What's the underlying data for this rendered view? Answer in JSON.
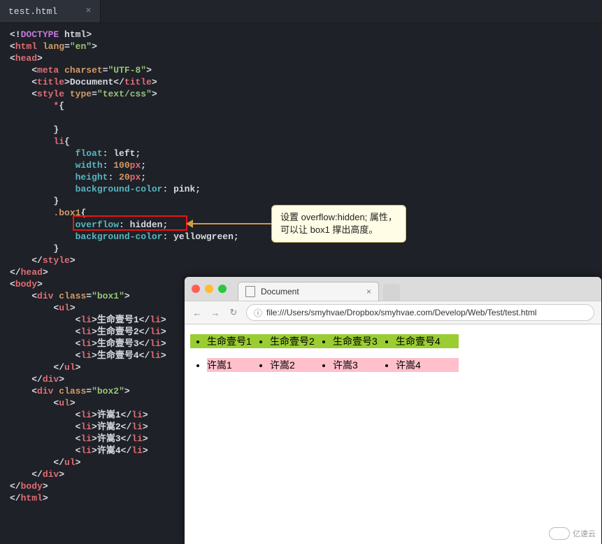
{
  "editor": {
    "tab": {
      "filename": "test.html",
      "close_glyph": "×"
    },
    "code": {
      "doctype": {
        "open": "<!",
        "tag": "DOCTYPE",
        "rest": " html",
        "close": ">"
      },
      "html_tag": {
        "name": "html",
        "attr": "lang",
        "val": "\"en\""
      },
      "head_tag": "head",
      "meta": {
        "name": "meta",
        "attr": "charset",
        "val": "\"UTF-8\""
      },
      "title": {
        "name": "title",
        "text": "Document"
      },
      "style": {
        "name": "style",
        "attr": "type",
        "val": "\"text/css\""
      },
      "rule_star": "*{",
      "rule_li": "li{",
      "li_props": {
        "float": {
          "k": "float",
          "v": "left"
        },
        "width": {
          "k": "width",
          "n": "100",
          "u": "px"
        },
        "height": {
          "k": "height",
          "n": "20",
          "u": "px"
        },
        "bgcolor": {
          "k": "background-color",
          "v": "pink"
        }
      },
      "box1_rule": {
        "sel": ".box1",
        "open": "{"
      },
      "overflow": {
        "k": "overflow",
        "v": "hidden"
      },
      "box1_bg": {
        "k": "background-color",
        "v": "yellowgreen"
      },
      "body_tag": "body",
      "div1": {
        "name": "div",
        "attr": "class",
        "val": "\"box1\""
      },
      "div2": {
        "name": "div",
        "attr": "class",
        "val": "\"box2\""
      },
      "ul_tag": "ul",
      "li_tag": "li",
      "list1": [
        "生命壹号1",
        "生命壹号2",
        "生命壹号3",
        "生命壹号4"
      ],
      "list2": [
        "许嵩1",
        "许嵩2",
        "许嵩3",
        "许嵩4"
      ]
    }
  },
  "callout": {
    "line1": "设置 overflow:hidden; 属性，",
    "line2": "可以让 box1 撑出高度。"
  },
  "browser": {
    "tab_title": "Document",
    "close_glyph": "×",
    "address": "file:///Users/smyhvae/Dropbox/smyhvae.com/Develop/Web/Test/test.html",
    "info_glyph": "ⓘ",
    "nav": {
      "back": "←",
      "fwd": "→",
      "reload": "↻"
    },
    "render": {
      "list1": [
        "生命壹号1",
        "生命壹号2",
        "生命壹号3",
        "生命壹号4"
      ],
      "list2": [
        "许嵩1",
        "许嵩2",
        "许嵩3",
        "许嵩4"
      ]
    }
  },
  "watermark": "亿速云"
}
